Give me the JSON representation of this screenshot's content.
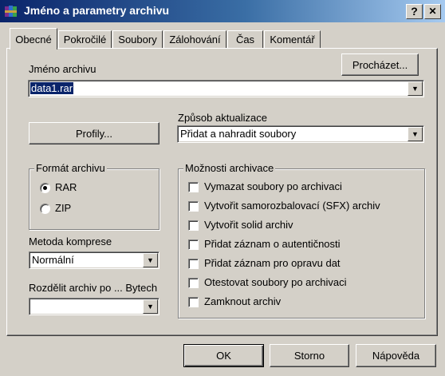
{
  "window": {
    "title": "Jméno a parametry archivu",
    "help_btn": "?",
    "close_btn": "✕"
  },
  "tabs": [
    {
      "label": "Obecné",
      "active": true
    },
    {
      "label": "Pokročilé",
      "active": false
    },
    {
      "label": "Soubory",
      "active": false
    },
    {
      "label": "Zálohování",
      "active": false
    },
    {
      "label": "Čas",
      "active": false
    },
    {
      "label": "Komentář",
      "active": false
    }
  ],
  "archive_name": {
    "label": "Jméno archivu",
    "value": "data1.rar",
    "browse_button": "Procházet..."
  },
  "profiles_button": "Profily...",
  "update_method": {
    "label": "Způsob aktualizace",
    "value": "Přidat a nahradit soubory"
  },
  "format": {
    "legend": "Formát archivu",
    "options": [
      {
        "label": "RAR",
        "selected": true
      },
      {
        "label": "ZIP",
        "selected": false
      }
    ]
  },
  "compression": {
    "label": "Metoda komprese",
    "value": "Normální"
  },
  "split": {
    "label": "Rozdělit archiv po ... Bytech",
    "value": ""
  },
  "options": {
    "legend": "Možnosti archivace",
    "items": [
      {
        "label": "Vymazat soubory po archivaci",
        "checked": false
      },
      {
        "label": "Vytvořit samorozbalovací (SFX) archiv",
        "checked": false
      },
      {
        "label": "Vytvořit solid archiv",
        "checked": false
      },
      {
        "label": "Přidat záznam o autentičnosti",
        "checked": false
      },
      {
        "label": "Přidat záznam pro opravu dat",
        "checked": false
      },
      {
        "label": "Otestovat soubory po archivaci",
        "checked": false
      },
      {
        "label": "Zamknout archiv",
        "checked": false
      }
    ]
  },
  "footer": {
    "ok": "OK",
    "cancel": "Storno",
    "help": "Nápověda"
  },
  "icons": {
    "app_icon": "winrar-books-icon",
    "dropdown_arrow": "▼"
  }
}
